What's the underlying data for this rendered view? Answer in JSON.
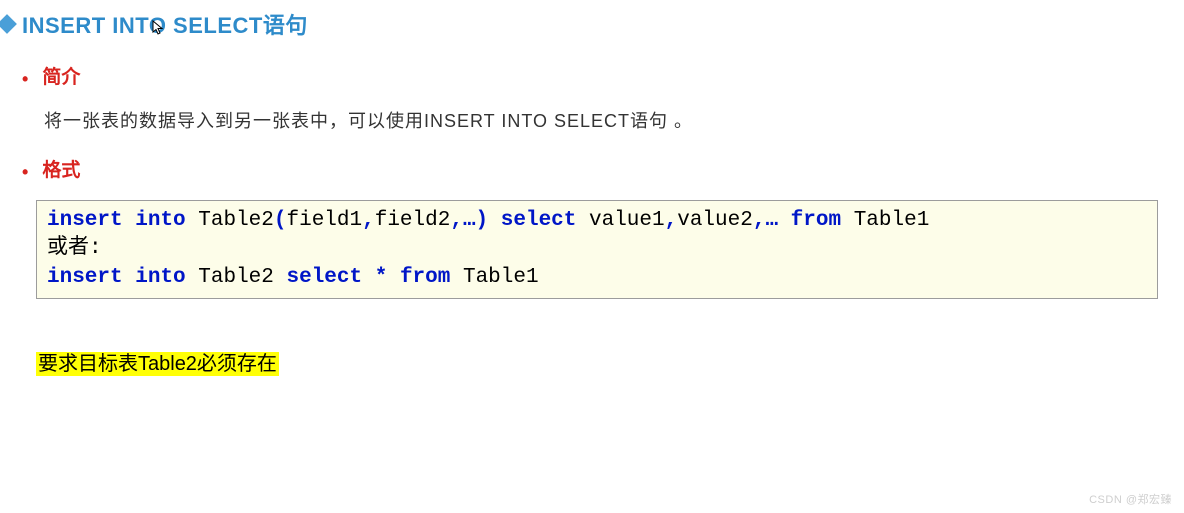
{
  "title": {
    "text": "INSERT INTO SELECT语句"
  },
  "sections": {
    "intro": {
      "label": "简介",
      "desc": "将一张表的数据导入到另一张表中，可以使用INSERT INTO SELECT语句 。"
    },
    "format": {
      "label": "格式",
      "code": {
        "line1_kw1": "insert",
        "line1_kw2": "into",
        "line1_txt1": " Table2",
        "line1_kw3": "(",
        "line1_txt2": "field1",
        "line1_kw4": ",",
        "line1_txt3": "field2",
        "line1_kw5": ",…)",
        "line1_kw6": "select",
        "line1_txt4": " value1",
        "line1_kw7": ",",
        "line1_txt5": "value2",
        "line1_kw8": ",…",
        "line1_kw9": "from",
        "line1_txt6": " Table1",
        "line2": "或者:",
        "line3_kw1": "insert",
        "line3_kw2": "into",
        "line3_txt1": " Table2 ",
        "line3_kw3": "select",
        "line3_kw4": "*",
        "line3_kw5": "from",
        "line3_txt2": " Table1"
      }
    }
  },
  "highlight": "要求目标表Table2必须存在",
  "watermark": "CSDN @郑宏臻"
}
